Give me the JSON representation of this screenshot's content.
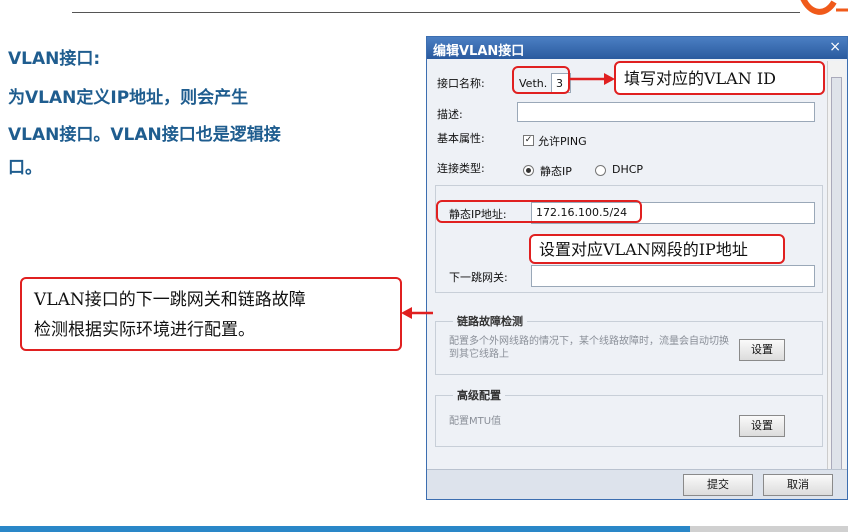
{
  "slide": {
    "heading": "VLAN接口:",
    "body_lines": [
      "为VLAN定义IP地址，则会产生",
      "VLAN接口。VLAN接口也是逻辑接",
      "口。"
    ],
    "callout_left_lines": [
      "VLAN接口的下一跳网关和链路故障",
      "检测根据实际环境进行配置。"
    ],
    "callout_vlan": "填写对应的VLAN ID",
    "callout_ip": "设置对应VLAN网段的IP地址"
  },
  "dialog": {
    "title": "编辑VLAN接口",
    "close": "×",
    "labels": {
      "interface_name": "接口名称:",
      "description": "描述:",
      "basic_attr": "基本属性:",
      "conn_type": "连接类型:",
      "static_ip": "静态IP地址:",
      "next_hop": "下一跳网关:"
    },
    "interface_prefix": "Veth.",
    "interface_id": "3",
    "allow_ping": "允许PING",
    "radio_static": "静态IP",
    "radio_dhcp": "DHCP",
    "static_ip_value": "172.16.100.5/24",
    "link_detect": {
      "title": "链路故障检测",
      "desc": "配置多个外网线路的情况下，某个线路故障时，流量会自动切换到其它线路上",
      "button": "设置"
    },
    "advanced": {
      "title": "高级配置",
      "desc": "配置MTU值",
      "button": "设置"
    },
    "submit": "提交",
    "cancel": "取消"
  },
  "colors": {
    "title_bar": "#2a5a9e",
    "callout_border": "#e02020",
    "slide_text": "#1f5d8f"
  }
}
